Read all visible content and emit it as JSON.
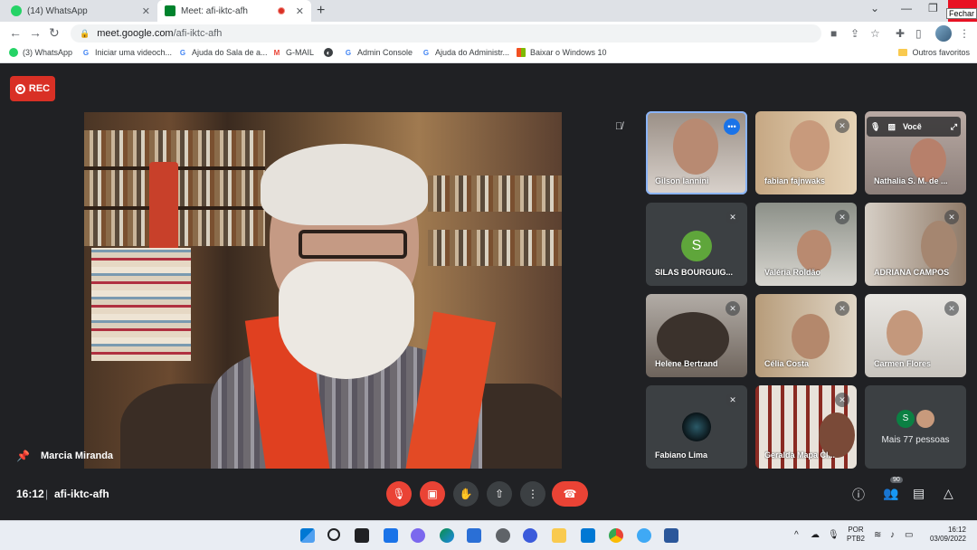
{
  "browser": {
    "tabs": [
      {
        "title": "(14) WhatsApp",
        "close": "✕",
        "favicon_color": "#25d366"
      },
      {
        "title": "Meet: afi-iktc-afh",
        "close": "✕",
        "favicon_color": "#00832d"
      }
    ],
    "new_tab": "+",
    "window_controls": {
      "minimize": "—",
      "maximize": "❐",
      "chevron": "⌄"
    },
    "close_tooltip": "Fechar",
    "url_host": "meet.google.com",
    "url_path": "/afi-iktc-afh",
    "bookmarks": [
      {
        "label": "(3) WhatsApp",
        "icon": "whatsapp-icon",
        "color": "#25d366",
        "glyph": ""
      },
      {
        "label": "Iniciar uma videoch...",
        "icon": "google-icon",
        "color": "#4285f4",
        "glyph": "G"
      },
      {
        "label": "Ajuda do Sala de a...",
        "icon": "google-icon",
        "color": "#4285f4",
        "glyph": "G"
      },
      {
        "label": "G-MAIL",
        "icon": "gmail-icon",
        "color": "#ea4335",
        "glyph": "M"
      },
      {
        "label": "Admin Console",
        "icon": "google-icon",
        "color": "#4285f4",
        "glyph": "G"
      },
      {
        "label": "Ajuda do Administr...",
        "icon": "google-icon",
        "color": "#4285f4",
        "glyph": "G"
      },
      {
        "label": "Baixar o Windows 10",
        "icon": "windows-icon",
        "color": "#0078d4",
        "glyph": ""
      }
    ],
    "other_bookmarks": "Outros favoritos"
  },
  "meet": {
    "rec_label": "REC",
    "pinned_name": "Marcia Miranda",
    "time": "16:12",
    "separator": "|",
    "meeting_code": "afi-iktc-afh",
    "participant_count": "90",
    "tiles": [
      {
        "name": "Gilson Iannini",
        "muted": false,
        "active": true
      },
      {
        "name": "fabian fajnwaks",
        "muted": true
      },
      {
        "name": "Nathalia S. M. de ...",
        "muted": true,
        "self_label": "Você"
      },
      {
        "name": "SILAS BOURGUIG...",
        "muted": true,
        "avatar": "S"
      },
      {
        "name": "Valéria Roldão",
        "muted": true
      },
      {
        "name": "ADRIANA CAMPOS",
        "muted": true
      },
      {
        "name": "Helene Bertrand",
        "muted": true
      },
      {
        "name": "Célia Costa",
        "muted": true
      },
      {
        "name": "Carmen Flores",
        "muted": true
      },
      {
        "name": "Fabiano Lima",
        "muted": true
      },
      {
        "name": "Geralda Mapa Cl...",
        "muted": true
      }
    ],
    "more_people": "Mais 77 pessoas",
    "more_avatar_letter": "S"
  },
  "taskbar": {
    "lang_top": "POR",
    "lang_bottom": "PTB2",
    "clock_time": "16:12",
    "clock_date": "03/09/2022"
  }
}
